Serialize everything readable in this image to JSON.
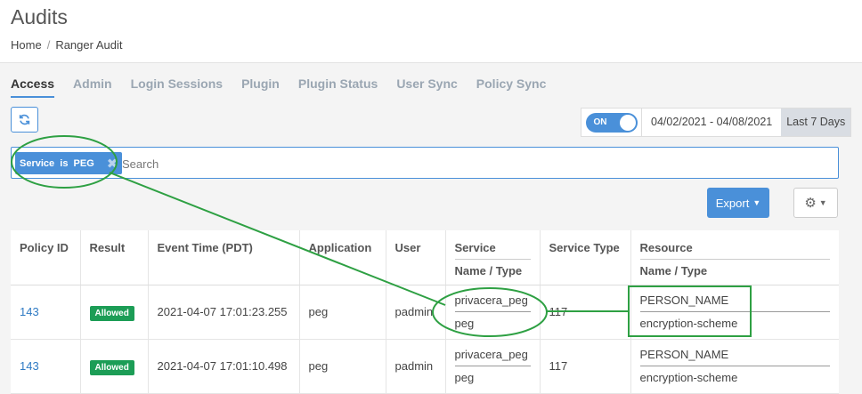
{
  "header": {
    "title": "Audits",
    "breadcrumb": [
      "Home",
      "Ranger Audit"
    ]
  },
  "tabs": [
    {
      "label": "Access",
      "active": true
    },
    {
      "label": "Admin"
    },
    {
      "label": "Login Sessions"
    },
    {
      "label": "Plugin"
    },
    {
      "label": "Plugin Status"
    },
    {
      "label": "User Sync"
    },
    {
      "label": "Policy Sync"
    }
  ],
  "toolbar": {
    "refresh_icon": "refresh-icon"
  },
  "date_filter": {
    "toggle": "ON",
    "range": "04/02/2021 - 04/08/2021",
    "preset": "Last 7 Days"
  },
  "search": {
    "tag": "Service  is  PEG",
    "placeholder": "Search"
  },
  "actions": {
    "export_label": "Export",
    "settings_icon": "gear-icon"
  },
  "table": {
    "headers": {
      "policy_id": "Policy ID",
      "result": "Result",
      "event_time": "Event Time (PDT)",
      "application": "Application",
      "user": "User",
      "service_top": "Service",
      "service_sub": "Name / Type",
      "service_type": "Service Type",
      "resource_top": "Resource",
      "resource_sub": "Name / Type"
    },
    "rows": [
      {
        "policy_id": "143",
        "result": "Allowed",
        "event_time": "2021-04-07 17:01:23.255",
        "application": "peg",
        "user": "padmin",
        "service_name": "privacera_peg",
        "service_type_short": "peg",
        "service_type": "117",
        "resource_name": "PERSON_NAME",
        "resource_type": "encryption-scheme"
      },
      {
        "policy_id": "143",
        "result": "Allowed",
        "event_time": "2021-04-07 17:01:10.498",
        "application": "peg",
        "user": "padmin",
        "service_name": "privacera_peg",
        "service_type_short": "peg",
        "service_type": "117",
        "resource_name": "PERSON_NAME",
        "resource_type": "encryption-scheme"
      }
    ]
  },
  "colors": {
    "accent": "#4a90d9",
    "allowed": "#1c9d56",
    "annotation": "#2ea043"
  }
}
